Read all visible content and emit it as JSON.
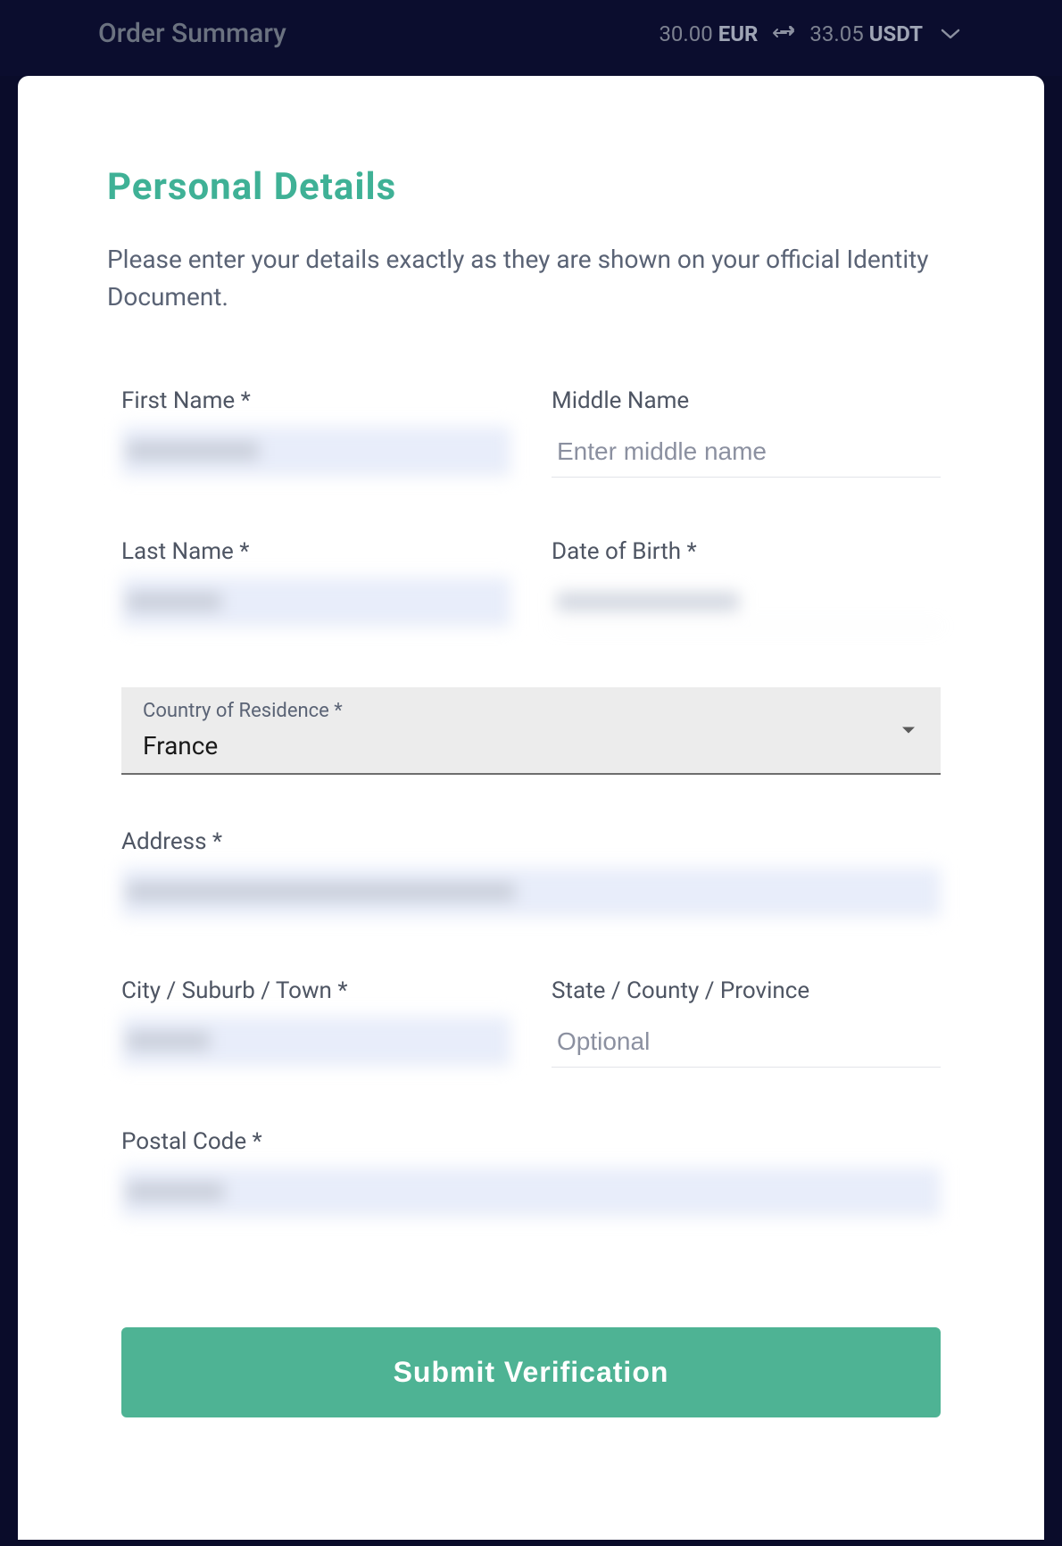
{
  "header": {
    "title": "Order Summary",
    "amount_from_value": "30.00",
    "amount_from_currency": "EUR",
    "amount_to_value": "33.05",
    "amount_to_currency": "USDT"
  },
  "form": {
    "title": "Personal Details",
    "description": "Please enter your details exactly as they are shown on your official Identity Document.",
    "fields": {
      "first_name": {
        "label": "First Name *",
        "value": ""
      },
      "middle_name": {
        "label": "Middle Name",
        "placeholder": "Enter middle name",
        "value": ""
      },
      "last_name": {
        "label": "Last Name *",
        "value": ""
      },
      "dob": {
        "label": "Date of Birth *",
        "value": ""
      },
      "country": {
        "label": "Country of Residence *",
        "value": "France"
      },
      "address": {
        "label": "Address *",
        "value": ""
      },
      "city": {
        "label": "City / Suburb / Town *",
        "value": ""
      },
      "state": {
        "label": "State / County / Province",
        "placeholder": "Optional",
        "value": ""
      },
      "postal_code": {
        "label": "Postal Code *",
        "value": ""
      }
    },
    "submit_label": "Submit Verification"
  }
}
